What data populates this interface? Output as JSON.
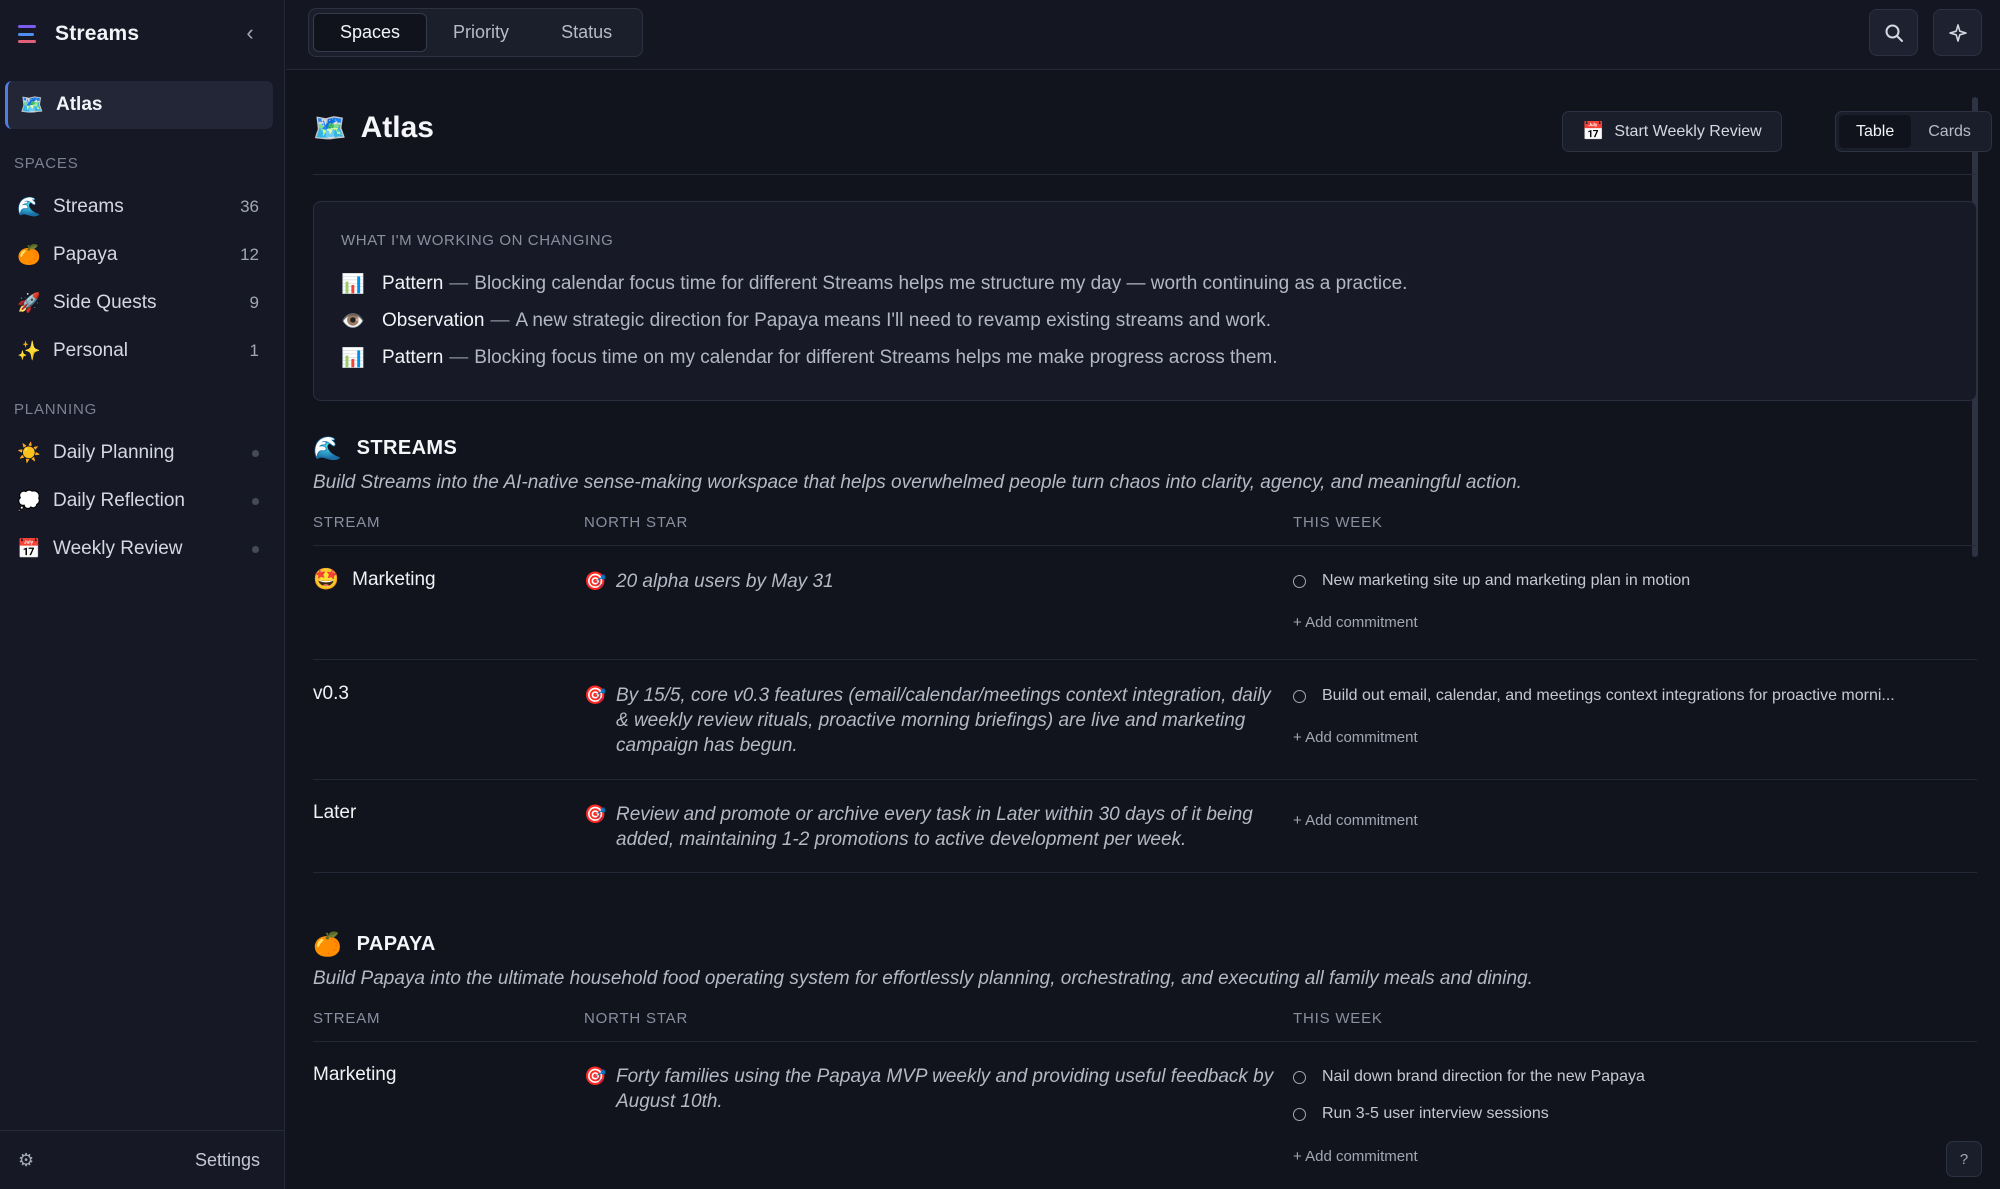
{
  "app": {
    "title": "Streams",
    "brand_colors": [
      "#7c5cf0",
      "#4f8df0",
      "#e0607a"
    ]
  },
  "sidebar": {
    "collapse_icon": "chevron-left-icon",
    "atlas": {
      "emoji": "🗺️",
      "label": "Atlas"
    },
    "spaces_label": "SPACES",
    "spaces": [
      {
        "emoji": "🌊",
        "label": "Streams",
        "count": "36"
      },
      {
        "emoji": "🍊",
        "label": "Papaya",
        "count": "12"
      },
      {
        "emoji": "🚀",
        "label": "Side Quests",
        "count": "9"
      },
      {
        "emoji": "✨",
        "label": "Personal",
        "count": "1"
      }
    ],
    "planning_label": "PLANNING",
    "planning": [
      {
        "emoji": "☀️",
        "label": "Daily Planning"
      },
      {
        "emoji": "💭",
        "label": "Daily Reflection"
      },
      {
        "emoji": "📅",
        "label": "Weekly Review"
      }
    ],
    "settings_icon": "gear-icon",
    "settings_label": "Settings"
  },
  "topbar": {
    "tabs": [
      "Spaces",
      "Priority",
      "Status"
    ],
    "active_tab": "Spaces",
    "search_icon": "search-icon",
    "sparkle_icon": "sparkle-icon"
  },
  "page": {
    "emoji": "🗺️",
    "title": "Atlas",
    "review_button": {
      "emoji": "📅",
      "label": "Start Weekly Review"
    },
    "view_options": [
      "Table",
      "Cards"
    ],
    "active_view": "Table"
  },
  "changing": {
    "heading": "WHAT I'M WORKING ON CHANGING",
    "items": [
      {
        "emoji": "📊",
        "kind": "Pattern",
        "sep": "—",
        "text": "Blocking calendar focus time for different Streams helps me structure my day — worth continuing as a practice."
      },
      {
        "emoji": "👁️",
        "kind": "Observation",
        "sep": "—",
        "text": "A new strategic direction for Papaya means I'll need to revamp existing streams and work."
      },
      {
        "emoji": "📊",
        "kind": "Pattern",
        "sep": "—",
        "text": "Blocking focus time on my calendar for different Streams helps me make progress across them."
      }
    ]
  },
  "columns": {
    "stream": "STREAM",
    "north_star": "NORTH STAR",
    "this_week": "THIS WEEK"
  },
  "add_commitment": "+ Add commitment",
  "target_emoji": "🎯",
  "spaces": [
    {
      "emoji": "🌊",
      "name": "STREAMS",
      "description": "Build Streams into the AI-native sense-making workspace that helps overwhelmed people turn chaos into clarity, agency, and meaningful action.",
      "rows": [
        {
          "emoji": "🤩",
          "stream": "Marketing",
          "north_star": "20 alpha users by May 31",
          "commitments": [
            "New marketing site up and marketing plan in motion"
          ]
        },
        {
          "emoji": "",
          "stream": "v0.3",
          "north_star": "By 15/5, core v0.3 features (email/calendar/meetings context integration, daily & weekly review rituals, proactive morning briefings) are live and marketing campaign has begun.",
          "commitments": [
            "Build out email, calendar, and meetings context integrations for proactive morni..."
          ]
        },
        {
          "emoji": "",
          "stream": "Later",
          "north_star": "Review and promote or archive every task in Later within 30 days of it being added, maintaining 1-2 promotions to active development per week.",
          "commitments": []
        }
      ]
    },
    {
      "emoji": "🍊",
      "name": "PAPAYA",
      "description": "Build Papaya into the ultimate household food operating system for effortlessly planning, orchestrating, and executing all family meals and dining.",
      "rows": [
        {
          "emoji": "",
          "stream": "Marketing",
          "north_star": "Forty families using the Papaya MVP weekly and providing useful feedback by August 10th.",
          "commitments": [
            "Nail down brand direction for the new Papaya",
            "Run 3-5 user interview sessions"
          ]
        }
      ]
    }
  ],
  "help_label": "?"
}
